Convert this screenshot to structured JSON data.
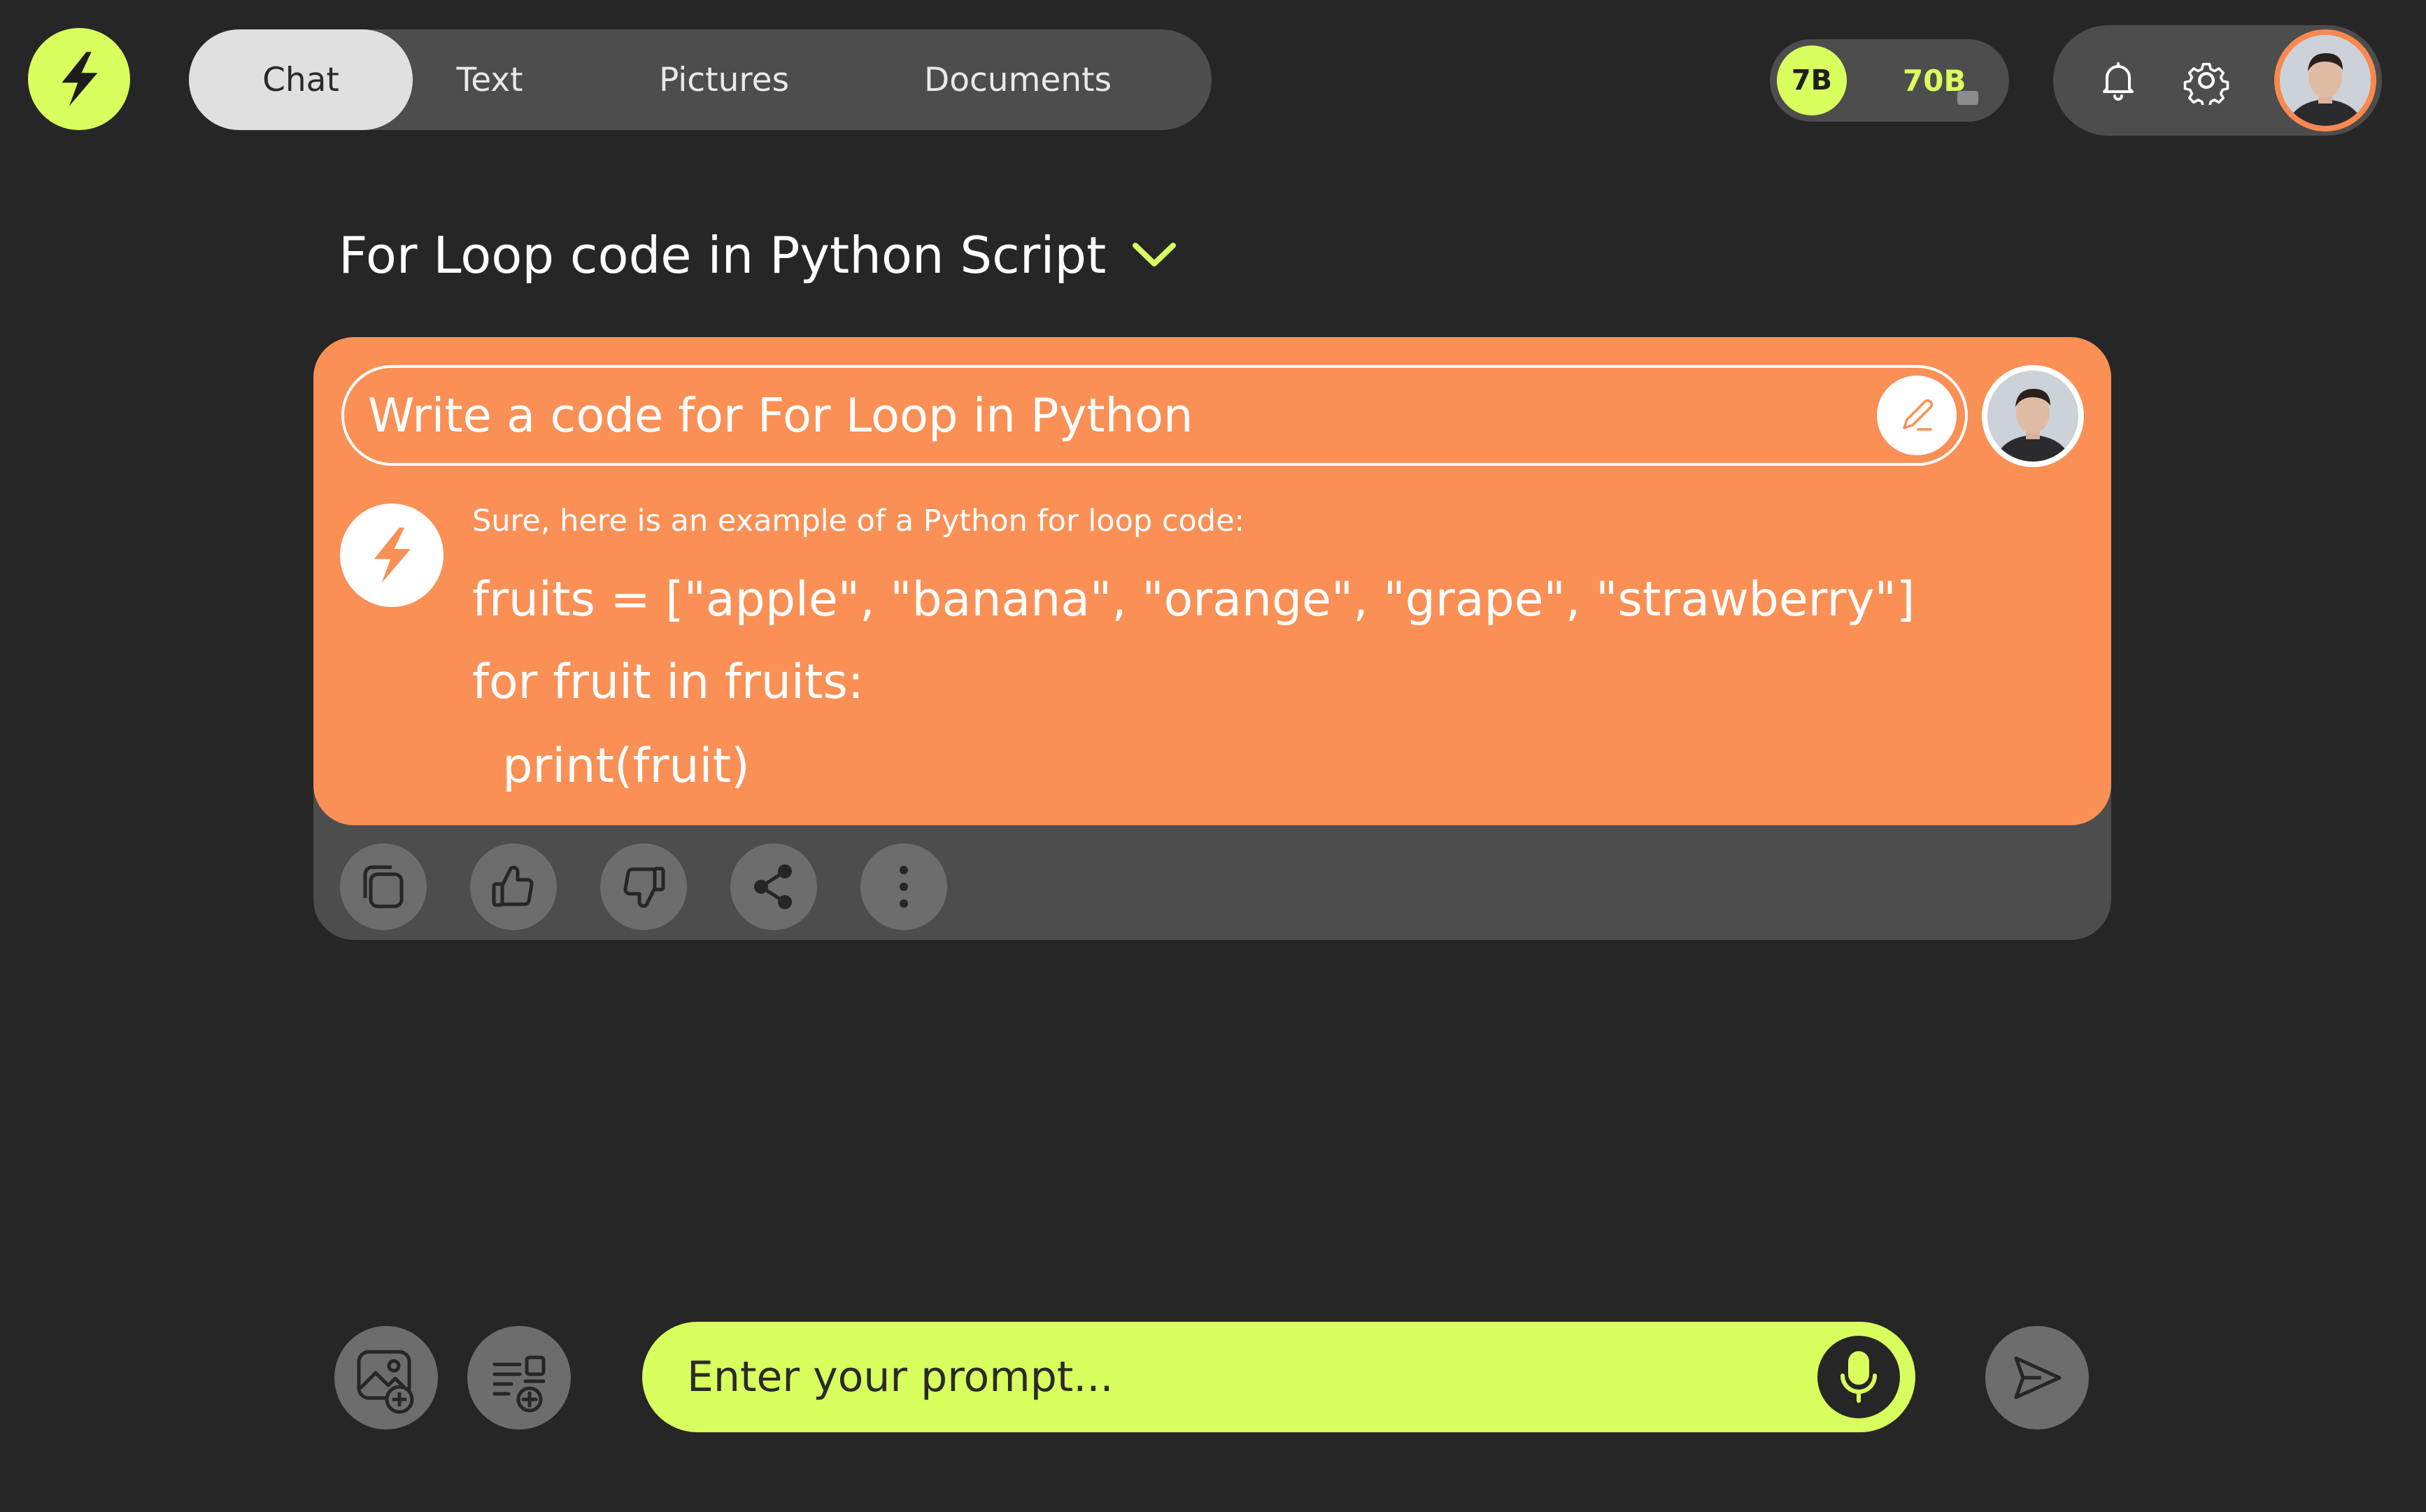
{
  "header": {
    "tabs": [
      {
        "label": "Chat",
        "active": true
      },
      {
        "label": "Text",
        "active": false
      },
      {
        "label": "Pictures",
        "active": false
      },
      {
        "label": "Documents",
        "active": false
      }
    ],
    "models": {
      "small": "7B",
      "large": "70B"
    },
    "icons": {
      "logo": "bolt-icon",
      "notifications": "bell-icon",
      "settings": "gear-icon",
      "avatar": "user-avatar"
    }
  },
  "chat": {
    "title": "For Loop code in Python Script",
    "user_prompt": "Write a code for For Loop in Python",
    "reply_intro": "Sure, here is an example of a Python for loop code:",
    "code_lines": [
      "fruits = [\"apple\", \"banana\", \"orange\", \"grape\", \"strawberry\"]",
      "for fruit in fruits:",
      "  print(fruit)"
    ],
    "actions": [
      "copy-icon",
      "thumbs-up-icon",
      "thumbs-down-icon",
      "share-icon",
      "more-icon"
    ]
  },
  "composer": {
    "placeholder": "Enter your prompt...",
    "icons": [
      "add-image-icon",
      "add-document-icon",
      "microphone-icon",
      "send-icon"
    ]
  },
  "colors": {
    "accent_lime": "#d8ff5e",
    "accent_orange": "#fa9055",
    "background": "#262626",
    "panel": "#4d4d4d"
  }
}
